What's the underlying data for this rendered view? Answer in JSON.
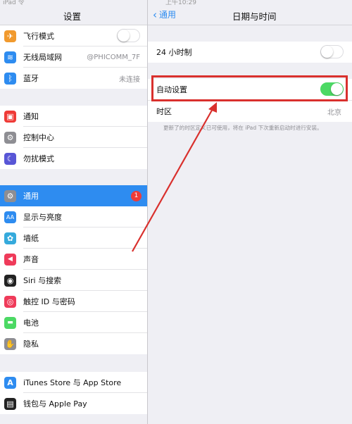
{
  "status": {
    "left": "iPad 令",
    "center": "上午10:29"
  },
  "sidebar": {
    "title": "设置",
    "group1": [
      {
        "label": "飞行模式",
        "icon": "airplane-icon",
        "color": "#f19a2e",
        "glyph": "✈",
        "toggle": false
      },
      {
        "label": "无线局域网",
        "icon": "wifi-icon",
        "color": "#2e8cf0",
        "glyph": "≋",
        "value": "@PHICOMM_7F"
      },
      {
        "label": "蓝牙",
        "icon": "bluetooth-icon",
        "color": "#2e8cf0",
        "glyph": "ᛒ",
        "value": "未连接"
      }
    ],
    "group2": [
      {
        "label": "通知",
        "icon": "notifications-icon",
        "color": "#ef3b37",
        "glyph": "▣"
      },
      {
        "label": "控制中心",
        "icon": "control-center-icon",
        "color": "#8e8e93",
        "glyph": "⚙"
      },
      {
        "label": "勿扰模式",
        "icon": "moon-icon",
        "color": "#5856d6",
        "glyph": "☾"
      }
    ],
    "group3": [
      {
        "label": "通用",
        "icon": "gear-icon",
        "color": "#8e8e93",
        "glyph": "⚙",
        "badge": "1",
        "selected": true
      },
      {
        "label": "显示与亮度",
        "icon": "display-icon",
        "color": "#2e8cf0",
        "glyph": "AA"
      },
      {
        "label": "墙纸",
        "icon": "wallpaper-icon",
        "color": "#35aadc",
        "glyph": "✿"
      },
      {
        "label": "声音",
        "icon": "sound-icon",
        "color": "#ef3b5a",
        "glyph": "◀"
      },
      {
        "label": "Siri 与搜索",
        "icon": "siri-icon",
        "color": "#222222",
        "glyph": "◉"
      },
      {
        "label": "触控 ID 与密码",
        "icon": "fingerprint-icon",
        "color": "#ef3b5a",
        "glyph": "◎"
      },
      {
        "label": "电池",
        "icon": "battery-icon",
        "color": "#4cd964",
        "glyph": "▬"
      },
      {
        "label": "隐私",
        "icon": "privacy-hand-icon",
        "color": "#8e8e93",
        "glyph": "✋"
      }
    ],
    "group4": [
      {
        "label": "iTunes Store 与 App Store",
        "icon": "app-store-icon",
        "color": "#2e8cf0",
        "glyph": "A"
      },
      {
        "label": "钱包与 Apple Pay",
        "icon": "wallet-icon",
        "color": "#222222",
        "glyph": "▤"
      }
    ]
  },
  "detail": {
    "back_label": "通用",
    "title": "日期与时间",
    "row_24h": {
      "label": "24 小时制",
      "toggle": false
    },
    "row_auto": {
      "label": "自动设置",
      "toggle": true
    },
    "row_tz": {
      "label": "时区",
      "value": "北京"
    },
    "footnote": "更新了的时区定义已可使用，将在 iPad 下次重新启动时进行安装。"
  },
  "colors": {
    "accent": "#2e8cf0",
    "highlight": "#d9302d",
    "toggle_on": "#4cd964"
  }
}
